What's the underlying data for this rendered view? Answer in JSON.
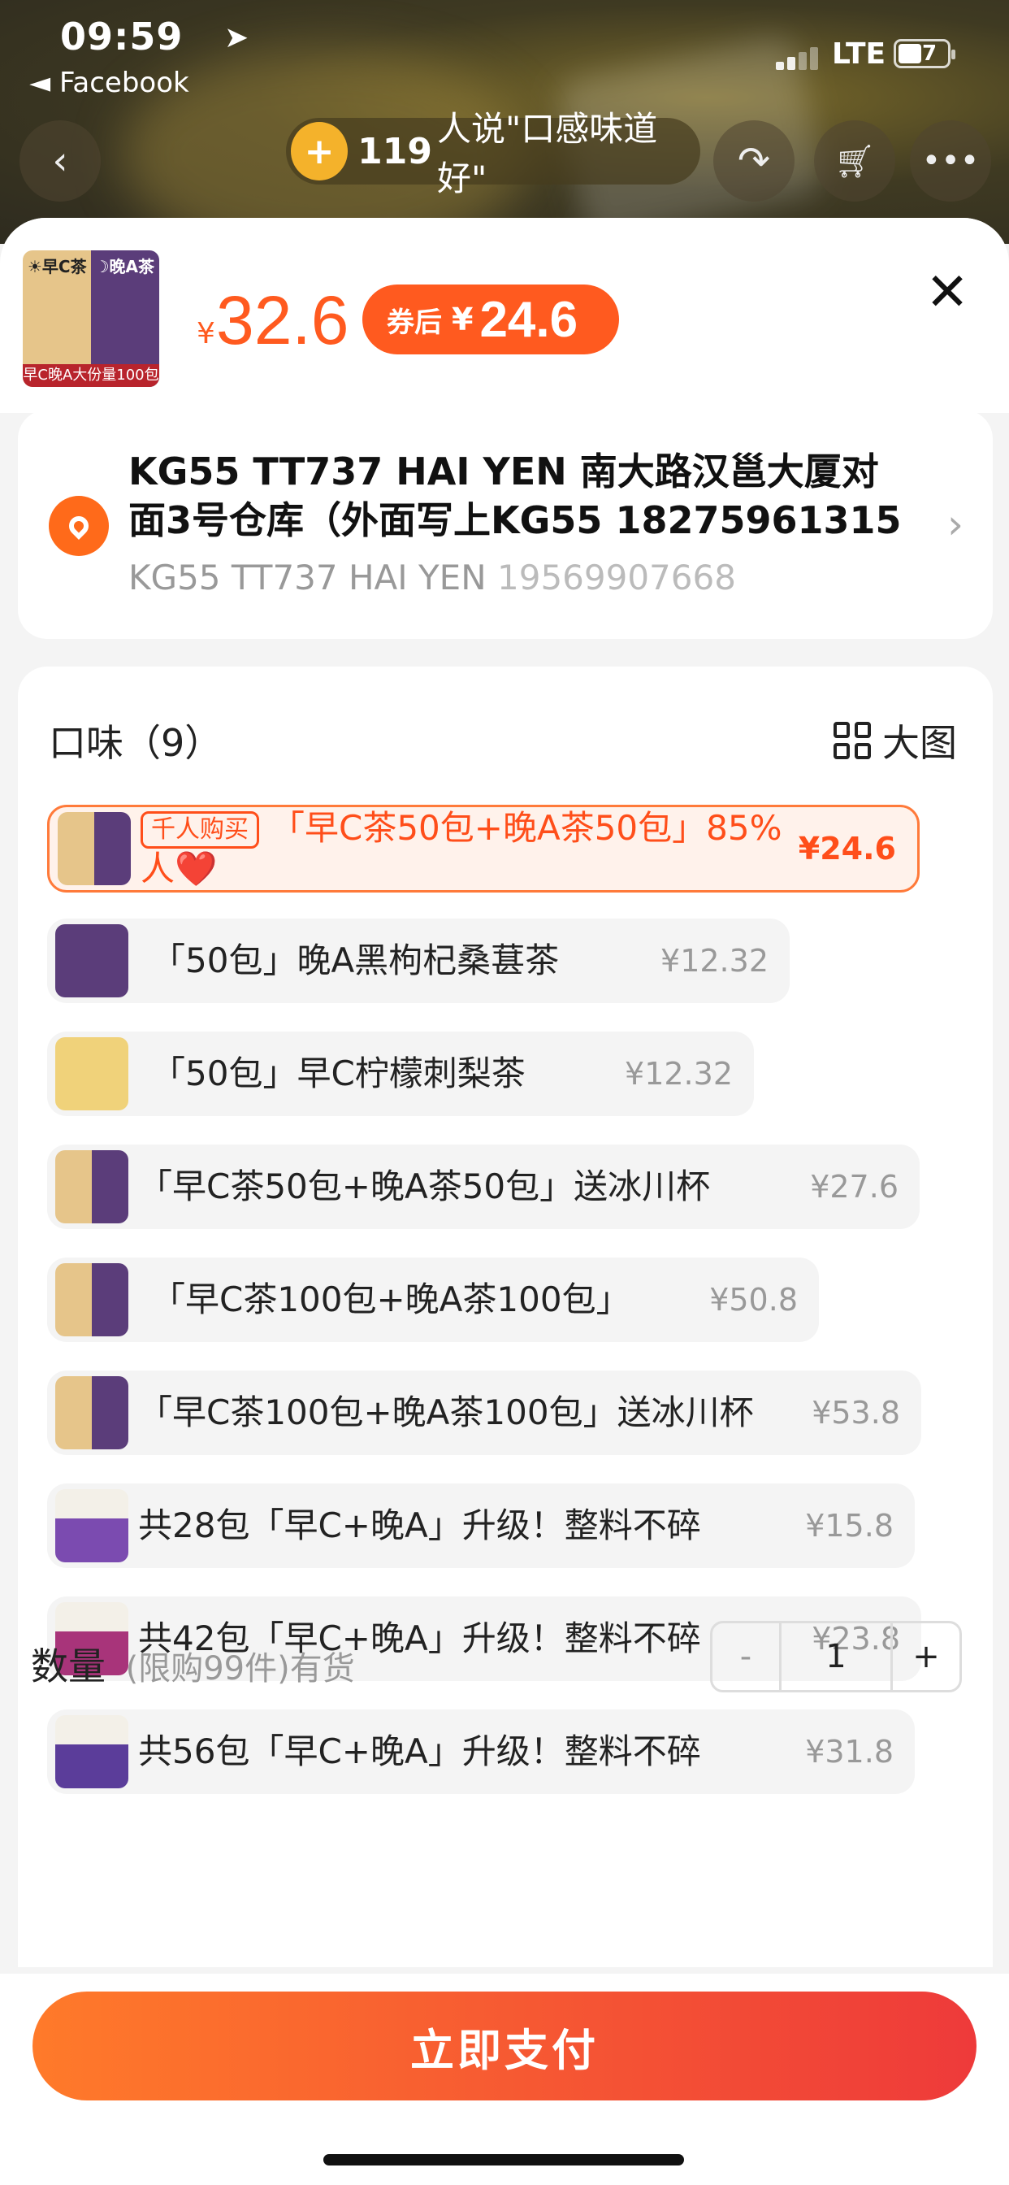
{
  "status": {
    "time": "09:59",
    "back_app": "◄ Facebook",
    "network": "LTE",
    "battery": "47"
  },
  "nav": {
    "promo_count": "119",
    "promo_text": "人说\"口感味道好\""
  },
  "product": {
    "thumb_left": "☀早C茶",
    "thumb_right": "☽晚A茶",
    "thumb_bottom": "早C晚A大份量100包",
    "price_symbol": "¥",
    "price": "32.6",
    "coupon_label": "券后",
    "coupon_symbol": "¥",
    "coupon_price": "24.6"
  },
  "address": {
    "line1": "KG55 TT737 HAI YEN 南大路汉邕大厦对",
    "line2": "面3号仓库（外面写上KG55 18275961315",
    "name": "KG55 TT737 HAI YEN",
    "phone": "19569907668"
  },
  "options": {
    "title": "口味（9）",
    "big_view": "大图",
    "items": [
      {
        "tag": "千人购买",
        "label": "「早C茶50包+晚A茶50包」85%人❤️",
        "price": "¥24.6"
      },
      {
        "label": "「50包」晚A黑枸杞桑葚茶",
        "price": "¥12.32"
      },
      {
        "label": "「50包」早C柠檬刺梨茶",
        "price": "¥12.32"
      },
      {
        "label": "「早C茶50包+晚A茶50包」送冰川杯",
        "price": "¥27.6"
      },
      {
        "label": "「早C茶100包+晚A茶100包」",
        "price": "¥50.8"
      },
      {
        "label": "「早C茶100包+晚A茶100包」送冰川杯",
        "price": "¥53.8"
      },
      {
        "label": "共28包「早C+晚A」升级！整料不碎",
        "price": "¥15.8"
      },
      {
        "label": "共42包「早C+晚A」升级！整料不碎",
        "price": "¥23.8"
      },
      {
        "label": "共56包「早C+晚A」升级！整料不碎",
        "price": "¥31.8"
      }
    ]
  },
  "quantity": {
    "label": "数量",
    "limit": "(限购99件)有货",
    "minus": "-",
    "value": "1",
    "plus": "+"
  },
  "footer": {
    "pay_label": "立即支付"
  },
  "colors": {
    "accent": "#ff5a1f",
    "pay_gradient_start": "#ff7a2a",
    "pay_gradient_end": "#ee3a3a"
  }
}
